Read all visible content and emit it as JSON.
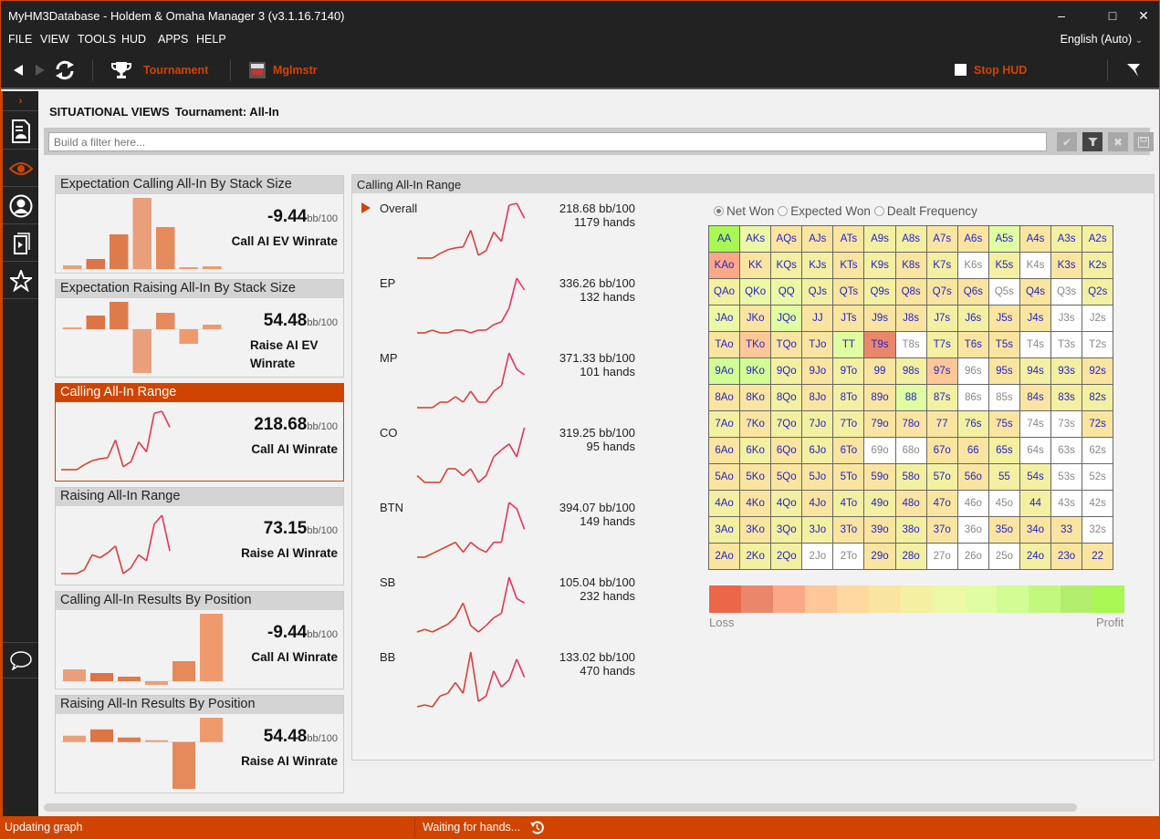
{
  "window": {
    "title": "MyHM3Database - Holdem & Omaha Manager 3 (v3.1.16.7140)",
    "controls": {
      "minimize": "–",
      "maximize": "□",
      "close": "✕"
    }
  },
  "menu": {
    "items": [
      "FILE",
      "VIEW",
      "TOOLS",
      "HUD",
      "APPS",
      "HELP"
    ],
    "language": "English (Auto)"
  },
  "toolbar": {
    "back_icon": "back-arrow-icon",
    "forward_icon": "forward-arrow-icon",
    "refresh_icon": "refresh-icon",
    "tournament_label": "Tournament",
    "player_label": "Mglmstr",
    "stop_hud_label": "Stop HUD",
    "accent": "#d04400"
  },
  "sidebar": {
    "expand_icon": "chevron-right-icon",
    "items": [
      {
        "icon": "reports-icon"
      },
      {
        "icon": "eye-icon",
        "active": true
      },
      {
        "icon": "player-icon"
      },
      {
        "icon": "replayer-icon"
      },
      {
        "icon": "star-icon"
      }
    ],
    "chat_icon": "chat-bubble-icon"
  },
  "page": {
    "section": "SITUATIONAL VIEWS",
    "view": "Tournament: All-In"
  },
  "filter": {
    "placeholder": "Build a filter here...",
    "value": "",
    "buttons": [
      "apply-check-icon",
      "filter-icon",
      "clear-x-icon",
      "save-icon"
    ]
  },
  "cards": [
    {
      "title": "Expectation Calling All-In By Stack Size",
      "value": "-9.44",
      "unit": "bb/100",
      "label": "Call AI EV Winrate",
      "type": "bar",
      "values": [
        4,
        11,
        38,
        78,
        46,
        2,
        3
      ]
    },
    {
      "title": "Expectation Raising All-In By Stack Size",
      "value": "54.48",
      "unit": "bb/100",
      "label": "Raise AI EV Winrate",
      "type": "bar",
      "values": [
        2,
        15,
        30,
        -48,
        18,
        -16,
        5
      ]
    },
    {
      "title": "Calling All-In Range",
      "value": "218.68",
      "unit": "bb/100",
      "label": "Call AI Winrate",
      "type": "line",
      "active": true,
      "values": [
        0,
        0,
        0,
        5,
        9,
        11,
        12,
        30,
        3,
        8,
        28,
        18,
        57,
        59,
        43
      ]
    },
    {
      "title": "Raising All-In Range",
      "value": "73.15",
      "unit": "bb/100",
      "label": "Raise AI Winrate",
      "type": "line",
      "values": [
        0,
        0,
        0,
        4,
        19,
        16,
        21,
        28,
        0,
        6,
        19,
        13,
        50,
        59,
        23
      ]
    },
    {
      "title": "Calling All-In Results By Position",
      "value": "-9.44",
      "unit": "bb/100",
      "label": "Call AI Winrate",
      "type": "bar",
      "values": [
        13,
        9,
        5,
        -4,
        22,
        74
      ]
    },
    {
      "title": "Raising All-In Results By Position",
      "value": "54.48",
      "unit": "bb/100",
      "label": "Raise AI Winrate",
      "type": "bar",
      "values": [
        7,
        14,
        5,
        2,
        -52,
        27
      ]
    }
  ],
  "range_panel": {
    "title": "Calling All-In Range",
    "rows": [
      {
        "name": "Overall",
        "winrate": "218.68 bb/100",
        "hands": "1179 hands",
        "selected": true,
        "values": [
          0,
          0,
          0,
          5,
          9,
          11,
          12,
          30,
          3,
          8,
          28,
          18,
          57,
          59,
          43
        ]
      },
      {
        "name": "EP",
        "winrate": "336.26 bb/100",
        "hands": "132 hands",
        "values": [
          0,
          0,
          3,
          0,
          0,
          3,
          3,
          0,
          3,
          3,
          9,
          12,
          27,
          60,
          47
        ]
      },
      {
        "name": "MP",
        "winrate": "371.33 bb/100",
        "hands": "101 hands",
        "values": [
          0,
          0,
          0,
          6,
          6,
          12,
          6,
          18,
          6,
          6,
          18,
          24,
          60,
          42,
          36
        ]
      },
      {
        "name": "CO",
        "winrate": "319.25 bb/100",
        "hands": "95 hands",
        "values": [
          8,
          0,
          0,
          0,
          16,
          16,
          8,
          16,
          0,
          8,
          30,
          38,
          45,
          30,
          64
        ]
      },
      {
        "name": "BTN",
        "winrate": "394.07 bb/100",
        "hands": "149 hands",
        "values": [
          0,
          0,
          6,
          12,
          18,
          24,
          8,
          24,
          14,
          8,
          24,
          24,
          88,
          78,
          45
        ]
      },
      {
        "name": "SB",
        "winrate": "105.04 bb/100",
        "hands": "232 hands",
        "values": [
          0,
          4,
          0,
          6,
          12,
          23,
          45,
          10,
          0,
          10,
          22,
          29,
          85,
          52,
          45
        ]
      },
      {
        "name": "BB",
        "winrate": "133.02 bb/100",
        "hands": "470 hands",
        "values": [
          0,
          2,
          0,
          12,
          15,
          27,
          15,
          61,
          6,
          12,
          40,
          22,
          30,
          53,
          33
        ]
      }
    ],
    "radio_options": [
      {
        "label": "Net Won",
        "selected": true
      },
      {
        "label": "Expected Won",
        "selected": false
      },
      {
        "label": "Dealt Frequency",
        "selected": false
      }
    ],
    "grid": [
      [
        [
          "AA",
          12
        ],
        [
          "AKs",
          7
        ],
        [
          "AQs",
          5
        ],
        [
          "AJs",
          5
        ],
        [
          "ATs",
          5
        ],
        [
          "A9s",
          6
        ],
        [
          "A8s",
          6
        ],
        [
          "A7s",
          5
        ],
        [
          "A6s",
          5
        ],
        [
          "A5s",
          8
        ],
        [
          "A4s",
          5
        ],
        [
          "A3s",
          6
        ],
        [
          "A2s",
          6
        ]
      ],
      [
        [
          "KAo",
          2
        ],
        [
          "KK",
          5
        ],
        [
          "KQs",
          6
        ],
        [
          "KJs",
          6
        ],
        [
          "KTs",
          5
        ],
        [
          "K9s",
          6
        ],
        [
          "K8s",
          5
        ],
        [
          "K7s",
          6
        ],
        [
          "K6s",
          "w"
        ],
        [
          "K5s",
          6
        ],
        [
          "K4s",
          "w"
        ],
        [
          "K3s",
          5
        ],
        [
          "K2s",
          6
        ]
      ],
      [
        [
          "QAo",
          6
        ],
        [
          "QKo",
          7
        ],
        [
          "QQ",
          7
        ],
        [
          "QJs",
          6
        ],
        [
          "QTs",
          5
        ],
        [
          "Q9s",
          6
        ],
        [
          "Q8s",
          5
        ],
        [
          "Q7s",
          5
        ],
        [
          "Q6s",
          5
        ],
        [
          "Q5s",
          "w"
        ],
        [
          "Q4s",
          5
        ],
        [
          "Q3s",
          "w"
        ],
        [
          "Q2s",
          6
        ]
      ],
      [
        [
          "JAo",
          7
        ],
        [
          "JKo",
          5
        ],
        [
          "JQo",
          8
        ],
        [
          "JJ",
          5
        ],
        [
          "JTs",
          5
        ],
        [
          "J9s",
          5
        ],
        [
          "J8s",
          5
        ],
        [
          "J7s",
          6
        ],
        [
          "J6s",
          6
        ],
        [
          "J5s",
          5
        ],
        [
          "J4s",
          5
        ],
        [
          "J3s",
          "w"
        ],
        [
          "J2s",
          "w"
        ]
      ],
      [
        [
          "TAo",
          5
        ],
        [
          "TKo",
          3
        ],
        [
          "TQo",
          5
        ],
        [
          "TJo",
          5
        ],
        [
          "TT",
          8
        ],
        [
          "T9s",
          1
        ],
        [
          "T8s",
          "w"
        ],
        [
          "T7s",
          6
        ],
        [
          "T6s",
          5
        ],
        [
          "T5s",
          5
        ],
        [
          "T4s",
          "w"
        ],
        [
          "T3s",
          "w"
        ],
        [
          "T2s",
          "w"
        ]
      ],
      [
        [
          "9Ao",
          9
        ],
        [
          "9Ko",
          9
        ],
        [
          "9Qo",
          6
        ],
        [
          "9Jo",
          5
        ],
        [
          "9To",
          6
        ],
        [
          "99",
          5
        ],
        [
          "98s",
          6
        ],
        [
          "97s",
          3
        ],
        [
          "96s",
          "w"
        ],
        [
          "95s",
          5
        ],
        [
          "94s",
          6
        ],
        [
          "93s",
          6
        ],
        [
          "92s",
          5
        ]
      ],
      [
        [
          "8Ao",
          5
        ],
        [
          "8Ko",
          5
        ],
        [
          "8Qo",
          6
        ],
        [
          "8Jo",
          5
        ],
        [
          "8To",
          6
        ],
        [
          "89o",
          5
        ],
        [
          "88",
          8
        ],
        [
          "87s",
          6
        ],
        [
          "86s",
          "w"
        ],
        [
          "85s",
          "w"
        ],
        [
          "84s",
          5
        ],
        [
          "83s",
          6
        ],
        [
          "82s",
          6
        ]
      ],
      [
        [
          "7Ao",
          6
        ],
        [
          "7Ko",
          5
        ],
        [
          "7Qo",
          6
        ],
        [
          "7Jo",
          6
        ],
        [
          "7To",
          6
        ],
        [
          "79o",
          5
        ],
        [
          "78o",
          5
        ],
        [
          "77",
          5
        ],
        [
          "76s",
          6
        ],
        [
          "75s",
          5
        ],
        [
          "74s",
          "w"
        ],
        [
          "73s",
          "w"
        ],
        [
          "72s",
          5
        ]
      ],
      [
        [
          "6Ao",
          5
        ],
        [
          "6Ko",
          6
        ],
        [
          "6Qo",
          5
        ],
        [
          "6Jo",
          6
        ],
        [
          "6To",
          5
        ],
        [
          "69o",
          "w"
        ],
        [
          "68o",
          "w"
        ],
        [
          "67o",
          5
        ],
        [
          "66",
          5
        ],
        [
          "65s",
          6
        ],
        [
          "64s",
          "w"
        ],
        [
          "63s",
          "w"
        ],
        [
          "62s",
          "w"
        ]
      ],
      [
        [
          "5Ao",
          5
        ],
        [
          "5Ko",
          5
        ],
        [
          "5Qo",
          5
        ],
        [
          "5Jo",
          5
        ],
        [
          "5To",
          5
        ],
        [
          "59o",
          5
        ],
        [
          "58o",
          6
        ],
        [
          "57o",
          6
        ],
        [
          "56o",
          5
        ],
        [
          "55",
          6
        ],
        [
          "54s",
          6
        ],
        [
          "53s",
          "w"
        ],
        [
          "52s",
          "w"
        ]
      ],
      [
        [
          "4Ao",
          6
        ],
        [
          "4Ko",
          5
        ],
        [
          "4Qo",
          6
        ],
        [
          "4Jo",
          5
        ],
        [
          "4To",
          6
        ],
        [
          "49o",
          6
        ],
        [
          "48o",
          5
        ],
        [
          "47o",
          5
        ],
        [
          "46o",
          "w"
        ],
        [
          "45o",
          "w"
        ],
        [
          "44",
          6
        ],
        [
          "43s",
          "w"
        ],
        [
          "42s",
          "w"
        ]
      ],
      [
        [
          "3Ao",
          6
        ],
        [
          "3Ko",
          5
        ],
        [
          "3Qo",
          6
        ],
        [
          "3Jo",
          6
        ],
        [
          "3To",
          5
        ],
        [
          "39o",
          5
        ],
        [
          "38o",
          6
        ],
        [
          "37o",
          5
        ],
        [
          "36o",
          "w"
        ],
        [
          "35o",
          5
        ],
        [
          "34o",
          5
        ],
        [
          "33",
          5
        ],
        [
          "32s",
          "w"
        ]
      ],
      [
        [
          "2Ao",
          5
        ],
        [
          "2Ko",
          6
        ],
        [
          "2Qo",
          6
        ],
        [
          "2Jo",
          "w"
        ],
        [
          "2To",
          "w"
        ],
        [
          "29o",
          5
        ],
        [
          "28o",
          6
        ],
        [
          "27o",
          "w"
        ],
        [
          "26o",
          "w"
        ],
        [
          "25o",
          "w"
        ],
        [
          "24o",
          6
        ],
        [
          "23o",
          5
        ],
        [
          "22",
          5
        ]
      ]
    ],
    "legend_colors": [
      "#ec6648",
      "#ea876b",
      "#fba889",
      "#fec797",
      "#fed8a0",
      "#fae5a0",
      "#f3f0a2",
      "#ecf8a5",
      "#e0fda1",
      "#d1fd94",
      "#c3f87f",
      "#b2ed6d",
      "#a8f753"
    ],
    "legend_low": "Loss",
    "legend_high": "Profit",
    "hand_text_color": "#2222cc",
    "empty_text_color": "#888888"
  },
  "status": {
    "left": "Updating graph",
    "right": "Waiting for hands...",
    "right_icon": "history-icon"
  }
}
